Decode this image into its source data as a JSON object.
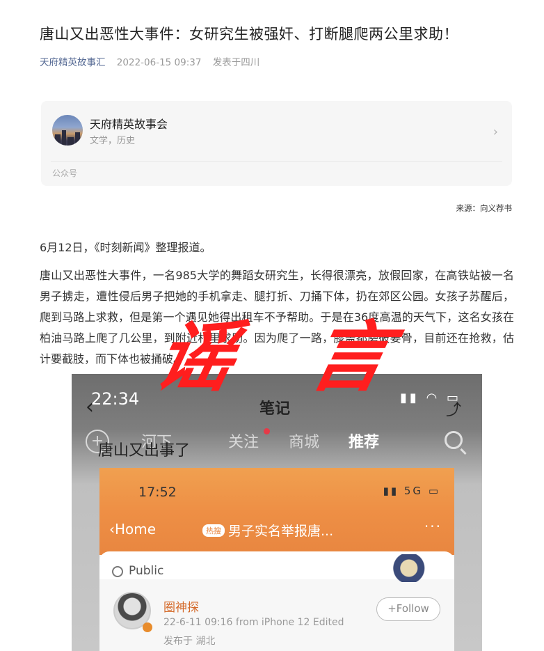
{
  "article": {
    "title": "唐山又出恶性大事件：女研究生被强奸、打断腿爬两公里求助！",
    "author": "天府精英故事汇",
    "date": "2022-06-15 09:37",
    "location": "发表于四川"
  },
  "account_card": {
    "name": "天府精英故事会",
    "subtitle": "文学，历史",
    "type": "公众号",
    "chevron_icon": "chevron-right-icon"
  },
  "source": "来源：向义荐书",
  "paragraphs": {
    "p1": "6月12日，《时刻新闻》整理报道。",
    "p2": "唐山又出恶性大事件，一名985大学的舞蹈女研究生，长得很漂亮，放假回家，在高铁站被一名男子掳走，遭性侵后男子把她的手机拿走、腿打折、刀捅下体，扔在郊区公园。女孩子苏醒后，爬到马路上求救，但是第一个遇见她得出租车不予帮助。于是在36度高温的天气下，这名女孩在柏油马路上爬了几公里，到附近村里求助。因为爬了一路，膝盖都磨破要骨，目前还在抢救，估计要截肢，而下体也被捅破。"
  },
  "stamp": {
    "char1": "谣",
    "char2": "言",
    "color": "#ff1e1e"
  },
  "screenshot": {
    "status_time": "22:34",
    "nav_title": "笔记",
    "tabs": [
      "河下",
      "关注",
      "商城",
      "推荐"
    ],
    "note_text": "唐山又出事了",
    "inner": {
      "time": "17:52",
      "status": "5G",
      "home": "Home",
      "tag": "热搜",
      "headline": "男子实名举报唐...",
      "more": "···",
      "public": "Public",
      "username": "圈神探",
      "user_info": "22-6-11 09:16  from iPhone 12  Edited",
      "location": "发布于 湖北",
      "follow": "+Follow"
    }
  }
}
